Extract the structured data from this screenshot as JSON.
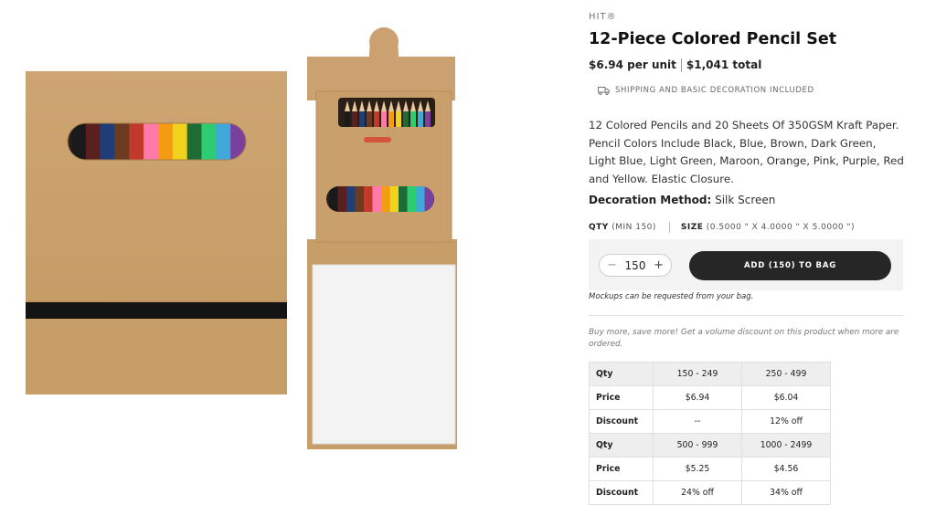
{
  "product": {
    "brand": "HIT®",
    "title": "12-Piece Colored Pencil Set",
    "price_per_unit": "$6.94 per unit",
    "total": "$1,041 total",
    "shipping_note": "SHIPPING AND BASIC DECORATION INCLUDED",
    "description": "12 Colored Pencils and 20 Sheets Of 350GSM Kraft Paper. Pencil Colors Include Black, Blue, Brown, Dark Green, Light Blue, Light Green, Maroon, Orange, Pink, Purple, Red and Yellow. Elastic Closure.",
    "decoration_label": "Decoration Method:",
    "decoration_value": "Silk Screen"
  },
  "specs": {
    "qty_label": "QTY",
    "qty_min": "(MIN 150)",
    "size_label": "SIZE",
    "size_value": "(0.5000 \" X 4.0000 \" X 5.0000 \")"
  },
  "buy": {
    "minus": "−",
    "quantity": "150",
    "plus": "+",
    "add_button": "ADD (150) TO BAG",
    "mockups_note": "Mockups can be requested from your bag."
  },
  "volume_note": "Buy more, save more! Get a volume discount on this product when more are ordered.",
  "pricing_table": {
    "row1": {
      "label": "Qty",
      "c1": "150 - 249",
      "c2": "250 - 499"
    },
    "row2": {
      "label": "Price",
      "c1": "$6.94",
      "c2": "$6.04"
    },
    "row3": {
      "label": "Discount",
      "c1": "--",
      "c2": "12% off"
    },
    "row4": {
      "label": "Qty",
      "c1": "500 - 999",
      "c2": "1000 - 2499"
    },
    "row5": {
      "label": "Price",
      "c1": "$5.25",
      "c2": "$4.56"
    },
    "row6": {
      "label": "Discount",
      "c1": "24% off",
      "c2": "34% off"
    }
  },
  "icons": {
    "shipping": "truck-icon"
  },
  "colors": {
    "kraft": "#c9a06b",
    "button": "#262626",
    "table_header": "#eeeeee",
    "pencils": [
      "#1a1a1a",
      "#5a1f1f",
      "#1f3e78",
      "#6b3a1f",
      "#c0392b",
      "#ff7aa8",
      "#f39c12",
      "#f1d21c",
      "#1e6b35",
      "#2ecc71",
      "#3fa9d9",
      "#7b3f9e"
    ]
  }
}
